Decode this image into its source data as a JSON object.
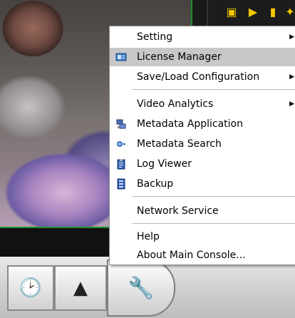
{
  "menu": {
    "items": [
      {
        "label": "Setting",
        "icon": "none",
        "submenu": true
      },
      {
        "label": "License Manager",
        "icon": "license-card-icon",
        "submenu": false,
        "highlighted": true
      },
      {
        "label": "Save/Load Configuration",
        "icon": "none",
        "submenu": true
      },
      {
        "label": "Video Analytics",
        "icon": "none",
        "submenu": true
      },
      {
        "label": "Metadata Application",
        "icon": "metadata-app-icon",
        "submenu": false
      },
      {
        "label": "Metadata Search",
        "icon": "search-icon",
        "submenu": false
      },
      {
        "label": "Log Viewer",
        "icon": "clipboard-icon",
        "submenu": false
      },
      {
        "label": "Backup",
        "icon": "backup-icon",
        "submenu": false
      },
      {
        "label": "Network Service",
        "icon": "none",
        "submenu": false
      },
      {
        "label": "Help",
        "icon": "none",
        "submenu": false
      },
      {
        "label": "About Main Console...",
        "icon": "none",
        "submenu": false
      }
    ],
    "submenu_glyph": "▶"
  },
  "toolbar": {
    "icons": [
      "monitor-icon",
      "playback-icon",
      "lock-icon",
      "network-icon"
    ],
    "glyphs": [
      "▣",
      "▶",
      "▮",
      "✦"
    ]
  },
  "bottombar": {
    "buttons": [
      {
        "name": "schedule-log-icon",
        "glyph": "🕑"
      },
      {
        "name": "alarm-warning-icon",
        "glyph": "▲"
      },
      {
        "name": "tools-icon",
        "glyph": "🔧"
      }
    ]
  },
  "colors": {
    "highlight": "#c8c8c8",
    "video_border": "#1d8e2d",
    "toolbar_icon": "#f0c800"
  }
}
